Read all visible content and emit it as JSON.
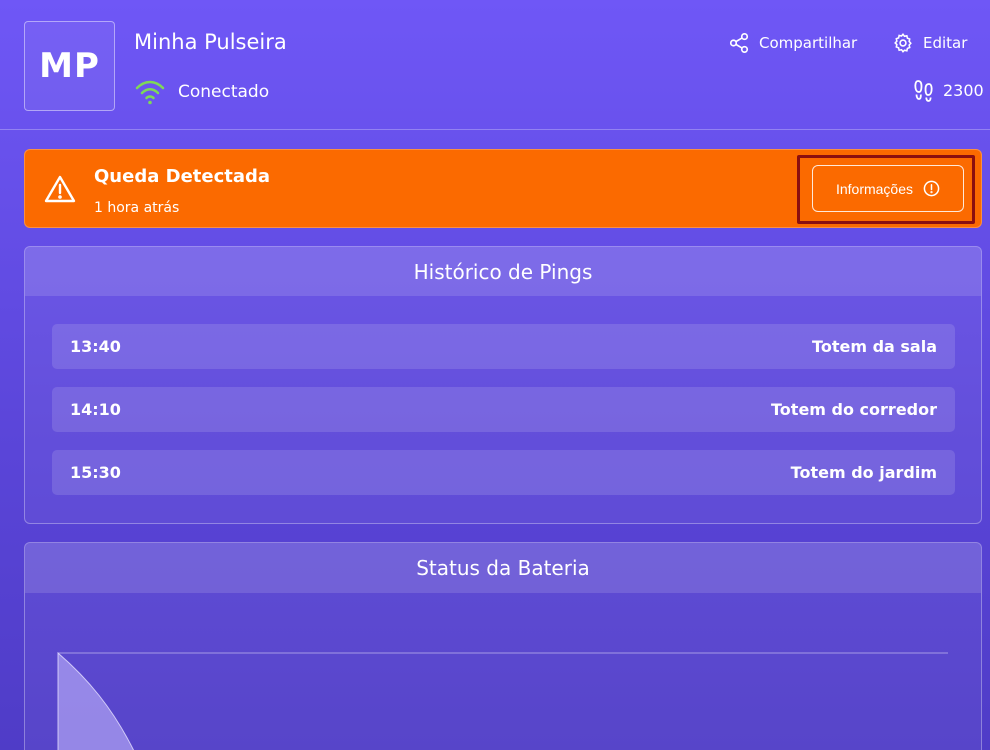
{
  "header": {
    "avatar_initials": "MP",
    "device_name": "Minha Pulseira",
    "status": "Conectado",
    "share_label": "Compartilhar",
    "edit_label": "Editar",
    "steps": "2300",
    "icons": {
      "status": "wifi-icon",
      "share": "share-icon",
      "edit": "gear-icon",
      "steps": "footprints-icon"
    },
    "status_color": "#7ed957"
  },
  "alert": {
    "title": "Queda Detectada",
    "time": "1 hora atrás",
    "button_label": "Informações",
    "icons": {
      "main": "warning-icon",
      "button": "info-icon"
    },
    "color": "#fb6a00"
  },
  "pings": {
    "title": "Histórico de Pings",
    "items": [
      {
        "time": "13:40",
        "location": "Totem da sala"
      },
      {
        "time": "14:10",
        "location": "Totem do corredor"
      },
      {
        "time": "15:30",
        "location": "Totem do jardim"
      }
    ]
  },
  "battery": {
    "title": "Status da Bateria"
  }
}
